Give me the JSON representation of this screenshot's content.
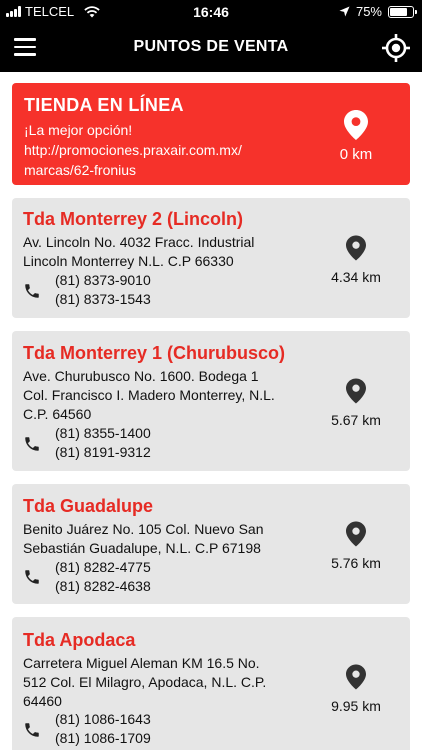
{
  "status_bar": {
    "carrier": "TELCEL",
    "time": "16:46",
    "battery": "75%",
    "battery_level": 0.75
  },
  "header": {
    "title": "PUNTOS DE VENTA"
  },
  "online_store": {
    "title": "TIENDA EN LÍNEA",
    "subtitle": "¡La mejor opción!",
    "url_line1": "http://promociones.praxair.com.mx/",
    "url_line2": "marcas/62-fronius",
    "distance": "0 km"
  },
  "stores": [
    {
      "name": "Tda Monterrey 2 (Lincoln)",
      "address": [
        "Av. Lincoln No. 4032  Fracc.  Industrial",
        "Lincoln Monterrey N.L. C.P 66330"
      ],
      "phones": [
        "(81) 8373-9010",
        "(81) 8373-1543"
      ],
      "distance": "4.34 km"
    },
    {
      "name": "Tda Monterrey 1 (Churubusco)",
      "address": [
        "Ave. Churubusco No. 1600. Bodega 1",
        "Col. Francisco I. Madero Monterrey, N.L.",
        "C.P. 64560"
      ],
      "phones": [
        "(81) 8355-1400",
        "(81) 8191-9312"
      ],
      "distance": "5.67 km"
    },
    {
      "name": "Tda Guadalupe",
      "address": [
        "Benito Juárez No. 105  Col. Nuevo San",
        "Sebastián Guadalupe, N.L.  C.P 67198"
      ],
      "phones": [
        "(81) 8282-4775",
        "(81) 8282-4638"
      ],
      "distance": "5.76 km"
    },
    {
      "name": "Tda Apodaca",
      "address": [
        "Carretera Miguel Aleman KM 16.5 No.",
        "512 Col. El Milagro, Apodaca, N.L. C.P.",
        "64460"
      ],
      "phones": [
        "(81) 1086-1643",
        "(81) 1086-1709"
      ],
      "distance": "9.95 km"
    }
  ]
}
